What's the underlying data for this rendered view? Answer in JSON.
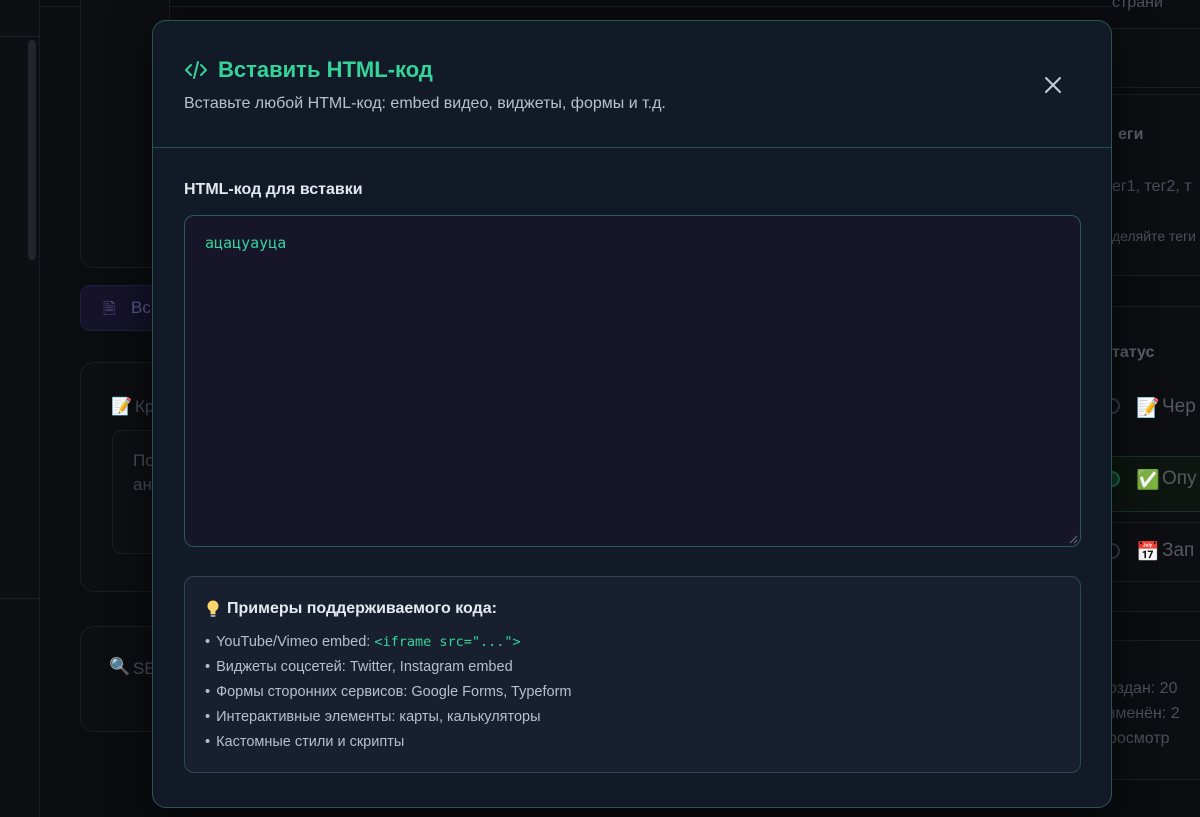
{
  "modal": {
    "title": "Вставить HTML-код",
    "subtitle": "Вставьте любой HTML-код: embed видео, виджеты, формы и т.д.",
    "field_label": "HTML-код для вставки",
    "code_value": "ацацуауца",
    "examples_title": "Примеры поддерживаемого кода:",
    "examples": [
      {
        "text": "YouTube/Vimeo embed: ",
        "code": "<iframe src=\"...\">"
      },
      {
        "text": "Виджеты соцсетей: Twitter, Instagram embed"
      },
      {
        "text": "Формы сторонних сервисов: Google Forms, Typeform"
      },
      {
        "text": "Интерактивные элементы: карты, калькуляторы"
      },
      {
        "text": "Кастомные стили и скрипты"
      }
    ],
    "bullet": "•",
    "accent_color": "#34d399",
    "icons": {
      "title": "code-icon",
      "close": "close-icon",
      "examples": "lightbulb-icon"
    }
  },
  "background": {
    "left_texts": {
      "pill": "Вс",
      "card_title": "Кр",
      "card_line1": "По",
      "card_line2": "ан",
      "seo": "SE"
    },
    "right": {
      "top_text": "страни",
      "tags_heading": "еги",
      "tags_placeholder": "ег1, тег2, т",
      "tags_hint": "деляйте теги",
      "status_heading": "татус",
      "status_draft": "Чер",
      "status_published": "Опу",
      "status_scheduled": "Зап",
      "created": "оздан: 20",
      "modified": "зменён: 2",
      "views": "росмотр"
    }
  }
}
